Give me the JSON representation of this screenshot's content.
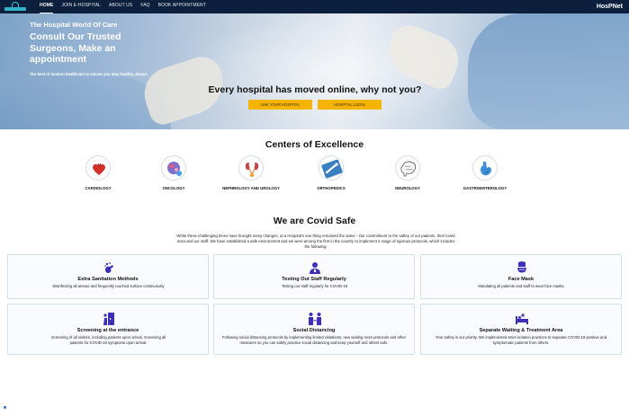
{
  "nav": {
    "items": [
      {
        "label": "HOME",
        "active": true
      },
      {
        "label": "JOIN E-HOSPITAL",
        "active": false
      },
      {
        "label": "ABOUT US",
        "active": false
      },
      {
        "label": "FAQ",
        "active": false
      },
      {
        "label": "BOOK APPOINTMENT",
        "active": false
      }
    ],
    "brand": "HosPNet"
  },
  "hero": {
    "kicker": "The Hospital World Of Care",
    "title": "Consult Our Trusted Surgeons, Make an appointment",
    "subtitle": "The best of modern healthcare to ensure you stay healthy, always",
    "cta": "Every hospital has moved online, why not you?",
    "link_button": "LINK YOUR HOSPITAL",
    "login_button": "HOSPITAL LOGIN"
  },
  "centers": {
    "title": "Centers of Excellence",
    "items": [
      {
        "label": "CARDIOLOGY",
        "icon": "heart-icon"
      },
      {
        "label": "ONCOLOGY",
        "icon": "cell-icon"
      },
      {
        "label": "NEPHROLOGY AND UROLOGY",
        "icon": "kidney-icon"
      },
      {
        "label": "ORTHOPEDICS",
        "icon": "bone-icon"
      },
      {
        "label": "NEUROLOGY",
        "icon": "brain-icon"
      },
      {
        "label": "GASTROENTEROLOGY",
        "icon": "stomach-icon"
      }
    ]
  },
  "covid": {
    "title": "We are Covid Safe",
    "intro": "While these challenging times have brought many changes, at a Hospital's one thing remained the same - Our commitment to the saftey of our patients, their loved ones and our staff. We have established a safe environment and we were among the first in the country to implement a range of rigorous protocols, which includes the following:",
    "cards": [
      {
        "title": "Extra Sanitation Methods",
        "desc": "Disinfecting all arenas and frequently touched surface continuously",
        "icon": "sanitizer-icon"
      },
      {
        "title": "Testing Out Staff Regularly",
        "desc": "Testing our staff regularly for COVID-19",
        "icon": "staff-icon"
      },
      {
        "title": "Face Mask",
        "desc": "Mandating all patients and staff to wear face masks.",
        "icon": "mask-icon"
      },
      {
        "title": "Screening at the entrance",
        "desc": "Screening of all visitors, including patients upon arrival. Screening all patients for COVID-19 symptoms upon arrival.",
        "icon": "entrance-icon"
      },
      {
        "title": "Social Distancing",
        "desc": "Following social distancing protocols by implementing limited visitations, new waiting room protocols and other measures so you can safely practice social distancing and keep yourself and others safe.",
        "icon": "distancing-icon"
      },
      {
        "title": "Separate Waiting & Treatment Area",
        "desc": "Your safety is our priority. We implemented strict isolation practices to separate COVID-19-positive and symptomatic patients from others.",
        "icon": "bed-icon"
      }
    ]
  },
  "colors": {
    "nav_bg": "#0c1f3d",
    "accent_button": "#f5b400",
    "icon_purple": "#3d2fb8"
  }
}
